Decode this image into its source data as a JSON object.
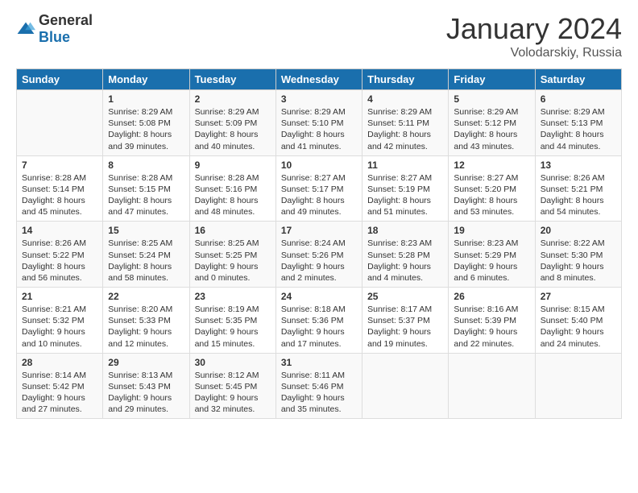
{
  "header": {
    "logo_general": "General",
    "logo_blue": "Blue",
    "month": "January 2024",
    "location": "Volodarskiy, Russia"
  },
  "days_of_week": [
    "Sunday",
    "Monday",
    "Tuesday",
    "Wednesday",
    "Thursday",
    "Friday",
    "Saturday"
  ],
  "weeks": [
    [
      {
        "day": "",
        "content": ""
      },
      {
        "day": "1",
        "content": "Sunrise: 8:29 AM\nSunset: 5:08 PM\nDaylight: 8 hours\nand 39 minutes."
      },
      {
        "day": "2",
        "content": "Sunrise: 8:29 AM\nSunset: 5:09 PM\nDaylight: 8 hours\nand 40 minutes."
      },
      {
        "day": "3",
        "content": "Sunrise: 8:29 AM\nSunset: 5:10 PM\nDaylight: 8 hours\nand 41 minutes."
      },
      {
        "day": "4",
        "content": "Sunrise: 8:29 AM\nSunset: 5:11 PM\nDaylight: 8 hours\nand 42 minutes."
      },
      {
        "day": "5",
        "content": "Sunrise: 8:29 AM\nSunset: 5:12 PM\nDaylight: 8 hours\nand 43 minutes."
      },
      {
        "day": "6",
        "content": "Sunrise: 8:29 AM\nSunset: 5:13 PM\nDaylight: 8 hours\nand 44 minutes."
      }
    ],
    [
      {
        "day": "7",
        "content": "Sunrise: 8:28 AM\nSunset: 5:14 PM\nDaylight: 8 hours\nand 45 minutes."
      },
      {
        "day": "8",
        "content": "Sunrise: 8:28 AM\nSunset: 5:15 PM\nDaylight: 8 hours\nand 47 minutes."
      },
      {
        "day": "9",
        "content": "Sunrise: 8:28 AM\nSunset: 5:16 PM\nDaylight: 8 hours\nand 48 minutes."
      },
      {
        "day": "10",
        "content": "Sunrise: 8:27 AM\nSunset: 5:17 PM\nDaylight: 8 hours\nand 49 minutes."
      },
      {
        "day": "11",
        "content": "Sunrise: 8:27 AM\nSunset: 5:19 PM\nDaylight: 8 hours\nand 51 minutes."
      },
      {
        "day": "12",
        "content": "Sunrise: 8:27 AM\nSunset: 5:20 PM\nDaylight: 8 hours\nand 53 minutes."
      },
      {
        "day": "13",
        "content": "Sunrise: 8:26 AM\nSunset: 5:21 PM\nDaylight: 8 hours\nand 54 minutes."
      }
    ],
    [
      {
        "day": "14",
        "content": "Sunrise: 8:26 AM\nSunset: 5:22 PM\nDaylight: 8 hours\nand 56 minutes."
      },
      {
        "day": "15",
        "content": "Sunrise: 8:25 AM\nSunset: 5:24 PM\nDaylight: 8 hours\nand 58 minutes."
      },
      {
        "day": "16",
        "content": "Sunrise: 8:25 AM\nSunset: 5:25 PM\nDaylight: 9 hours\nand 0 minutes."
      },
      {
        "day": "17",
        "content": "Sunrise: 8:24 AM\nSunset: 5:26 PM\nDaylight: 9 hours\nand 2 minutes."
      },
      {
        "day": "18",
        "content": "Sunrise: 8:23 AM\nSunset: 5:28 PM\nDaylight: 9 hours\nand 4 minutes."
      },
      {
        "day": "19",
        "content": "Sunrise: 8:23 AM\nSunset: 5:29 PM\nDaylight: 9 hours\nand 6 minutes."
      },
      {
        "day": "20",
        "content": "Sunrise: 8:22 AM\nSunset: 5:30 PM\nDaylight: 9 hours\nand 8 minutes."
      }
    ],
    [
      {
        "day": "21",
        "content": "Sunrise: 8:21 AM\nSunset: 5:32 PM\nDaylight: 9 hours\nand 10 minutes."
      },
      {
        "day": "22",
        "content": "Sunrise: 8:20 AM\nSunset: 5:33 PM\nDaylight: 9 hours\nand 12 minutes."
      },
      {
        "day": "23",
        "content": "Sunrise: 8:19 AM\nSunset: 5:35 PM\nDaylight: 9 hours\nand 15 minutes."
      },
      {
        "day": "24",
        "content": "Sunrise: 8:18 AM\nSunset: 5:36 PM\nDaylight: 9 hours\nand 17 minutes."
      },
      {
        "day": "25",
        "content": "Sunrise: 8:17 AM\nSunset: 5:37 PM\nDaylight: 9 hours\nand 19 minutes."
      },
      {
        "day": "26",
        "content": "Sunrise: 8:16 AM\nSunset: 5:39 PM\nDaylight: 9 hours\nand 22 minutes."
      },
      {
        "day": "27",
        "content": "Sunrise: 8:15 AM\nSunset: 5:40 PM\nDaylight: 9 hours\nand 24 minutes."
      }
    ],
    [
      {
        "day": "28",
        "content": "Sunrise: 8:14 AM\nSunset: 5:42 PM\nDaylight: 9 hours\nand 27 minutes."
      },
      {
        "day": "29",
        "content": "Sunrise: 8:13 AM\nSunset: 5:43 PM\nDaylight: 9 hours\nand 29 minutes."
      },
      {
        "day": "30",
        "content": "Sunrise: 8:12 AM\nSunset: 5:45 PM\nDaylight: 9 hours\nand 32 minutes."
      },
      {
        "day": "31",
        "content": "Sunrise: 8:11 AM\nSunset: 5:46 PM\nDaylight: 9 hours\nand 35 minutes."
      },
      {
        "day": "",
        "content": ""
      },
      {
        "day": "",
        "content": ""
      },
      {
        "day": "",
        "content": ""
      }
    ]
  ]
}
